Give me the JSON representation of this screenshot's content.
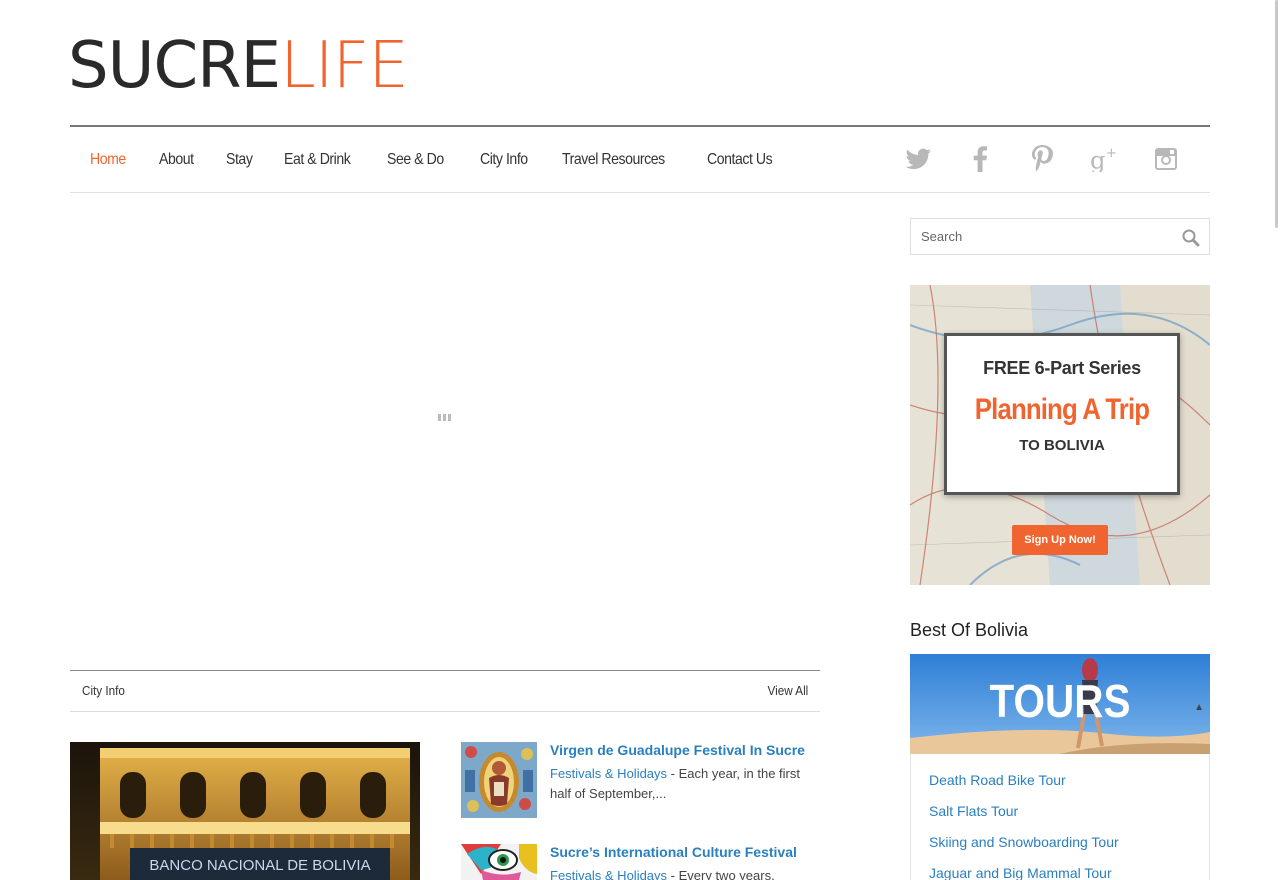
{
  "logo": {
    "part1": "SUCRE",
    "part2": "LIFE"
  },
  "nav": {
    "links": [
      "Home",
      "About",
      "Stay",
      "Eat & Drink",
      "See & Do",
      "City Info",
      "Travel Resources",
      "Contact Us"
    ],
    "active": "Home"
  },
  "social": [
    "twitter-icon",
    "facebook-icon",
    "pinterest-icon",
    "google-plus-icon",
    "instagram-icon"
  ],
  "section": {
    "title": "City Info",
    "view_all": "View All"
  },
  "feature": {
    "sign_text": "BANCO NACIONAL DE BOLIVIA"
  },
  "articles": [
    {
      "title": "Virgen de Guadalupe Festival In Sucre",
      "category": "Festivals & Holidays",
      "excerpt": " - Each year, in the first half of September,..."
    },
    {
      "title": "Sucre’s International Culture Festival",
      "category": "Festivals & Holidays",
      "excerpt": " - Every two years,"
    }
  ],
  "search": {
    "placeholder": "Search"
  },
  "banner": {
    "line1": "FREE 6-Part Series",
    "line2": "Planning A Trip",
    "line3": "TO BOLIVIA",
    "button": "Sign Up Now!"
  },
  "best_of": {
    "title": "Best Of Bolivia",
    "banner_label": "TOURS",
    "tours": [
      "Death Road Bike Tour",
      "Salt Flats Tour",
      "Skiing and Snowboarding Tour",
      "Jaguar and Big Mammal Tour"
    ]
  },
  "colors": {
    "accent": "#f0652f",
    "link": "#2a7fbf",
    "social_grey": "#b8b8b8"
  }
}
